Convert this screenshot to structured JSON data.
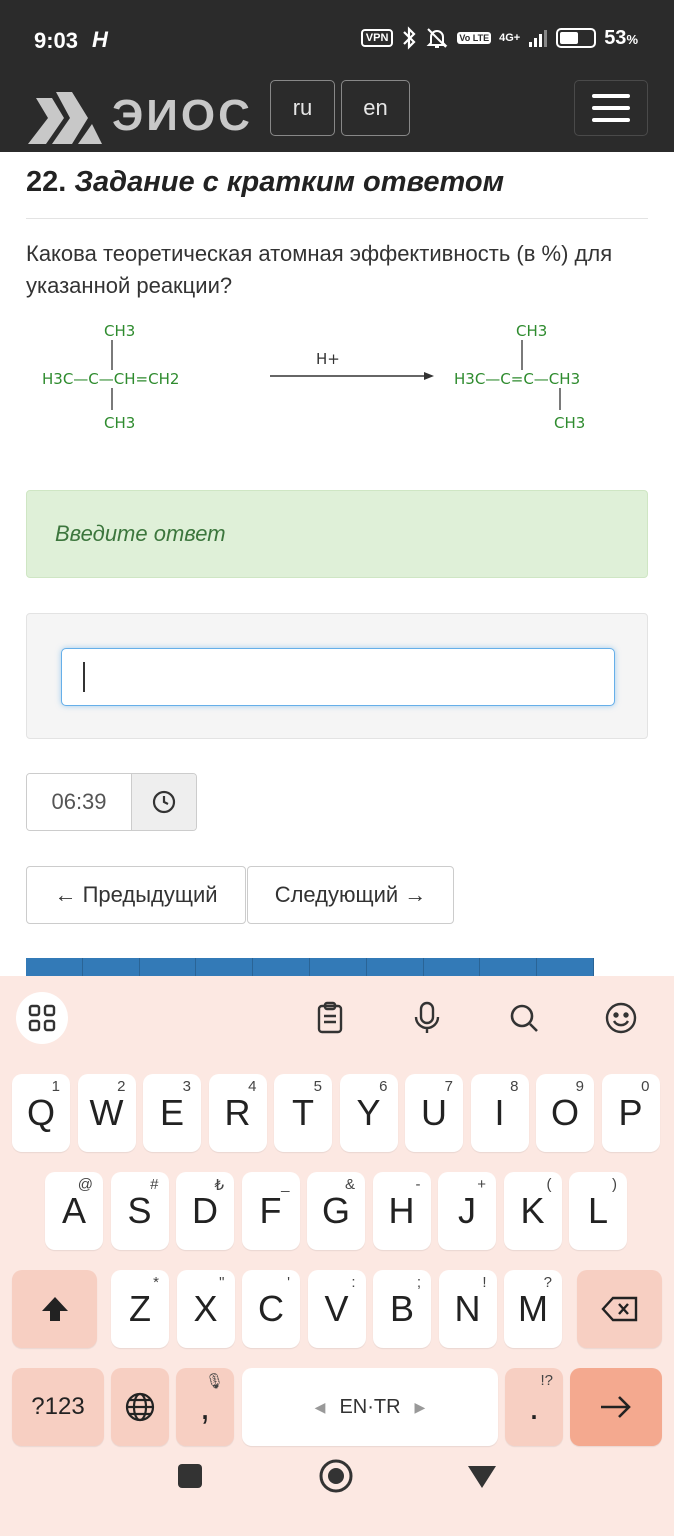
{
  "status": {
    "time": "9:03",
    "carrier_icon": "H",
    "vpn": "VPN",
    "lte": "Vo LTE",
    "net": "4G+",
    "battery": "53",
    "battery_unit": "%"
  },
  "navbar": {
    "brand": "ЭИОС",
    "lang_ru": "ru",
    "lang_en": "en"
  },
  "task": {
    "number": "22.",
    "title": "Задание с кратким ответом",
    "question": "Какова теоретическая атомная эффективность (в %) для указанной реакции?"
  },
  "reaction": {
    "left_top": "CH3",
    "left_main": "H3C—C—CH=CH2",
    "left_bottom": "CH3",
    "catalyst": "H+",
    "right_top": "CH3",
    "right_main": "H3C—C=C—CH3",
    "right_bottom": "CH3"
  },
  "answer": {
    "hint": "Введите ответ",
    "value": ""
  },
  "timer": {
    "value": "06:39"
  },
  "nav_buttons": {
    "prev": "← Предыдущий",
    "next": "Следующий →"
  },
  "keyboard": {
    "row1": [
      {
        "k": "Q",
        "s": "1"
      },
      {
        "k": "W",
        "s": "2"
      },
      {
        "k": "E",
        "s": "3"
      },
      {
        "k": "R",
        "s": "4"
      },
      {
        "k": "T",
        "s": "5"
      },
      {
        "k": "Y",
        "s": "6"
      },
      {
        "k": "U",
        "s": "7"
      },
      {
        "k": "I",
        "s": "8"
      },
      {
        "k": "O",
        "s": "9"
      },
      {
        "k": "P",
        "s": "0"
      }
    ],
    "row2": [
      {
        "k": "A",
        "s": "@"
      },
      {
        "k": "S",
        "s": "#"
      },
      {
        "k": "D",
        "s": "₺"
      },
      {
        "k": "F",
        "s": "_"
      },
      {
        "k": "G",
        "s": "&"
      },
      {
        "k": "H",
        "s": "-"
      },
      {
        "k": "J",
        "s": "+"
      },
      {
        "k": "K",
        "s": "("
      },
      {
        "k": "L",
        "s": ")"
      }
    ],
    "row3": [
      {
        "k": "Z",
        "s": "*"
      },
      {
        "k": "X",
        "s": "\""
      },
      {
        "k": "C",
        "s": "'"
      },
      {
        "k": "V",
        "s": ":"
      },
      {
        "k": "B",
        "s": ";"
      },
      {
        "k": "N",
        "s": "!"
      },
      {
        "k": "M",
        "s": "?"
      }
    ],
    "symbols": "?123",
    "comma": ",",
    "space": "EN·TR",
    "period": ".",
    "period_sup": "!?"
  }
}
